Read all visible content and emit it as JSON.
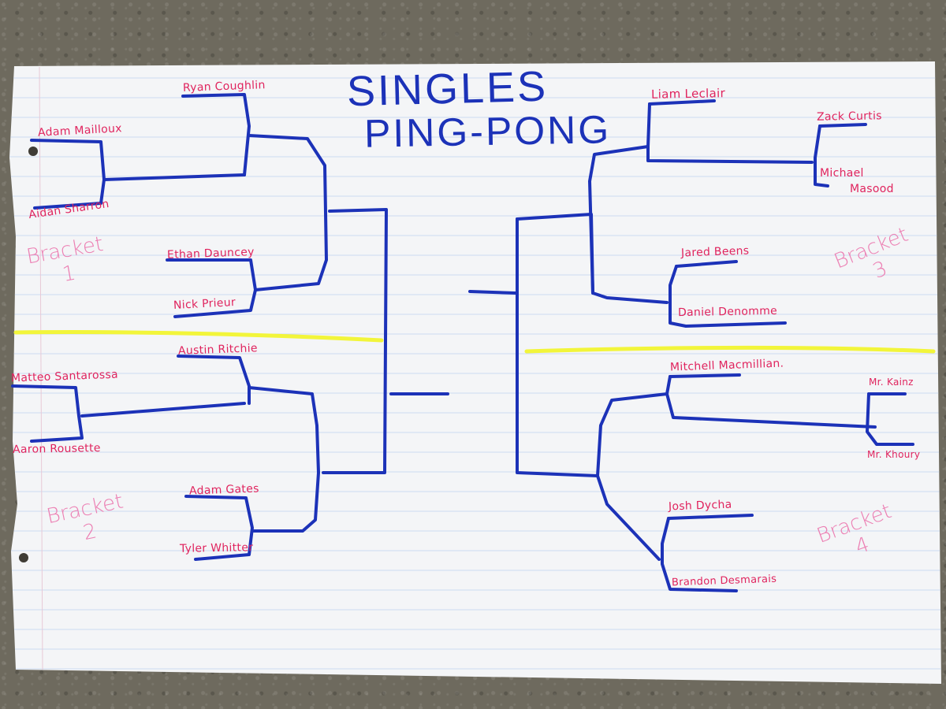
{
  "title": {
    "line1": "SINGLES",
    "line2": "PING-PONG"
  },
  "brackets": [
    {
      "word": "Bracket",
      "number": "1"
    },
    {
      "word": "Bracket",
      "number": "2"
    },
    {
      "word": "Bracket",
      "number": "3"
    },
    {
      "word": "Bracket",
      "number": "4"
    }
  ],
  "players": {
    "adam_mailloux": "Adam Mailloux",
    "aidan_sharron": "Aidan Sharron",
    "ryan_coughlin": "Ryan Coughlin",
    "ethan_dauncey": "Ethan Dauncey",
    "nick_prieur": "Nick Prieur",
    "matteo_santarossa": "Matteo Santarossa",
    "aaron_rousette": "Aaron Rousette",
    "austin_ritchie": "Austin Ritchie",
    "adam_gates": "Adam Gates",
    "tyler_whitter": "Tyler Whitter",
    "liam_leclair": "Liam Leclair",
    "zack_curtis": "Zack Curtis",
    "michael_masood_1": "Michael",
    "michael_masood_2": "Masood",
    "jared_beens": "Jared Beens",
    "daniel_denomme": "Daniel Denomme",
    "mitchell_macmillan": "Mitchell Macmillian.",
    "mr_kainz": "Mr. Kainz",
    "mr_khoury": "Mr. Khoury",
    "josh_dycha": "Josh Dycha",
    "brandon_desmarais": "Brandon Desmarais"
  },
  "colors": {
    "ink_blue": "#1c32b8",
    "ink_red": "#e0245e",
    "ink_pink": "#ec7fb3",
    "highlighter": "#f2f53a",
    "paper": "#f4f5f7",
    "rule_line": "#c9d7ef"
  }
}
